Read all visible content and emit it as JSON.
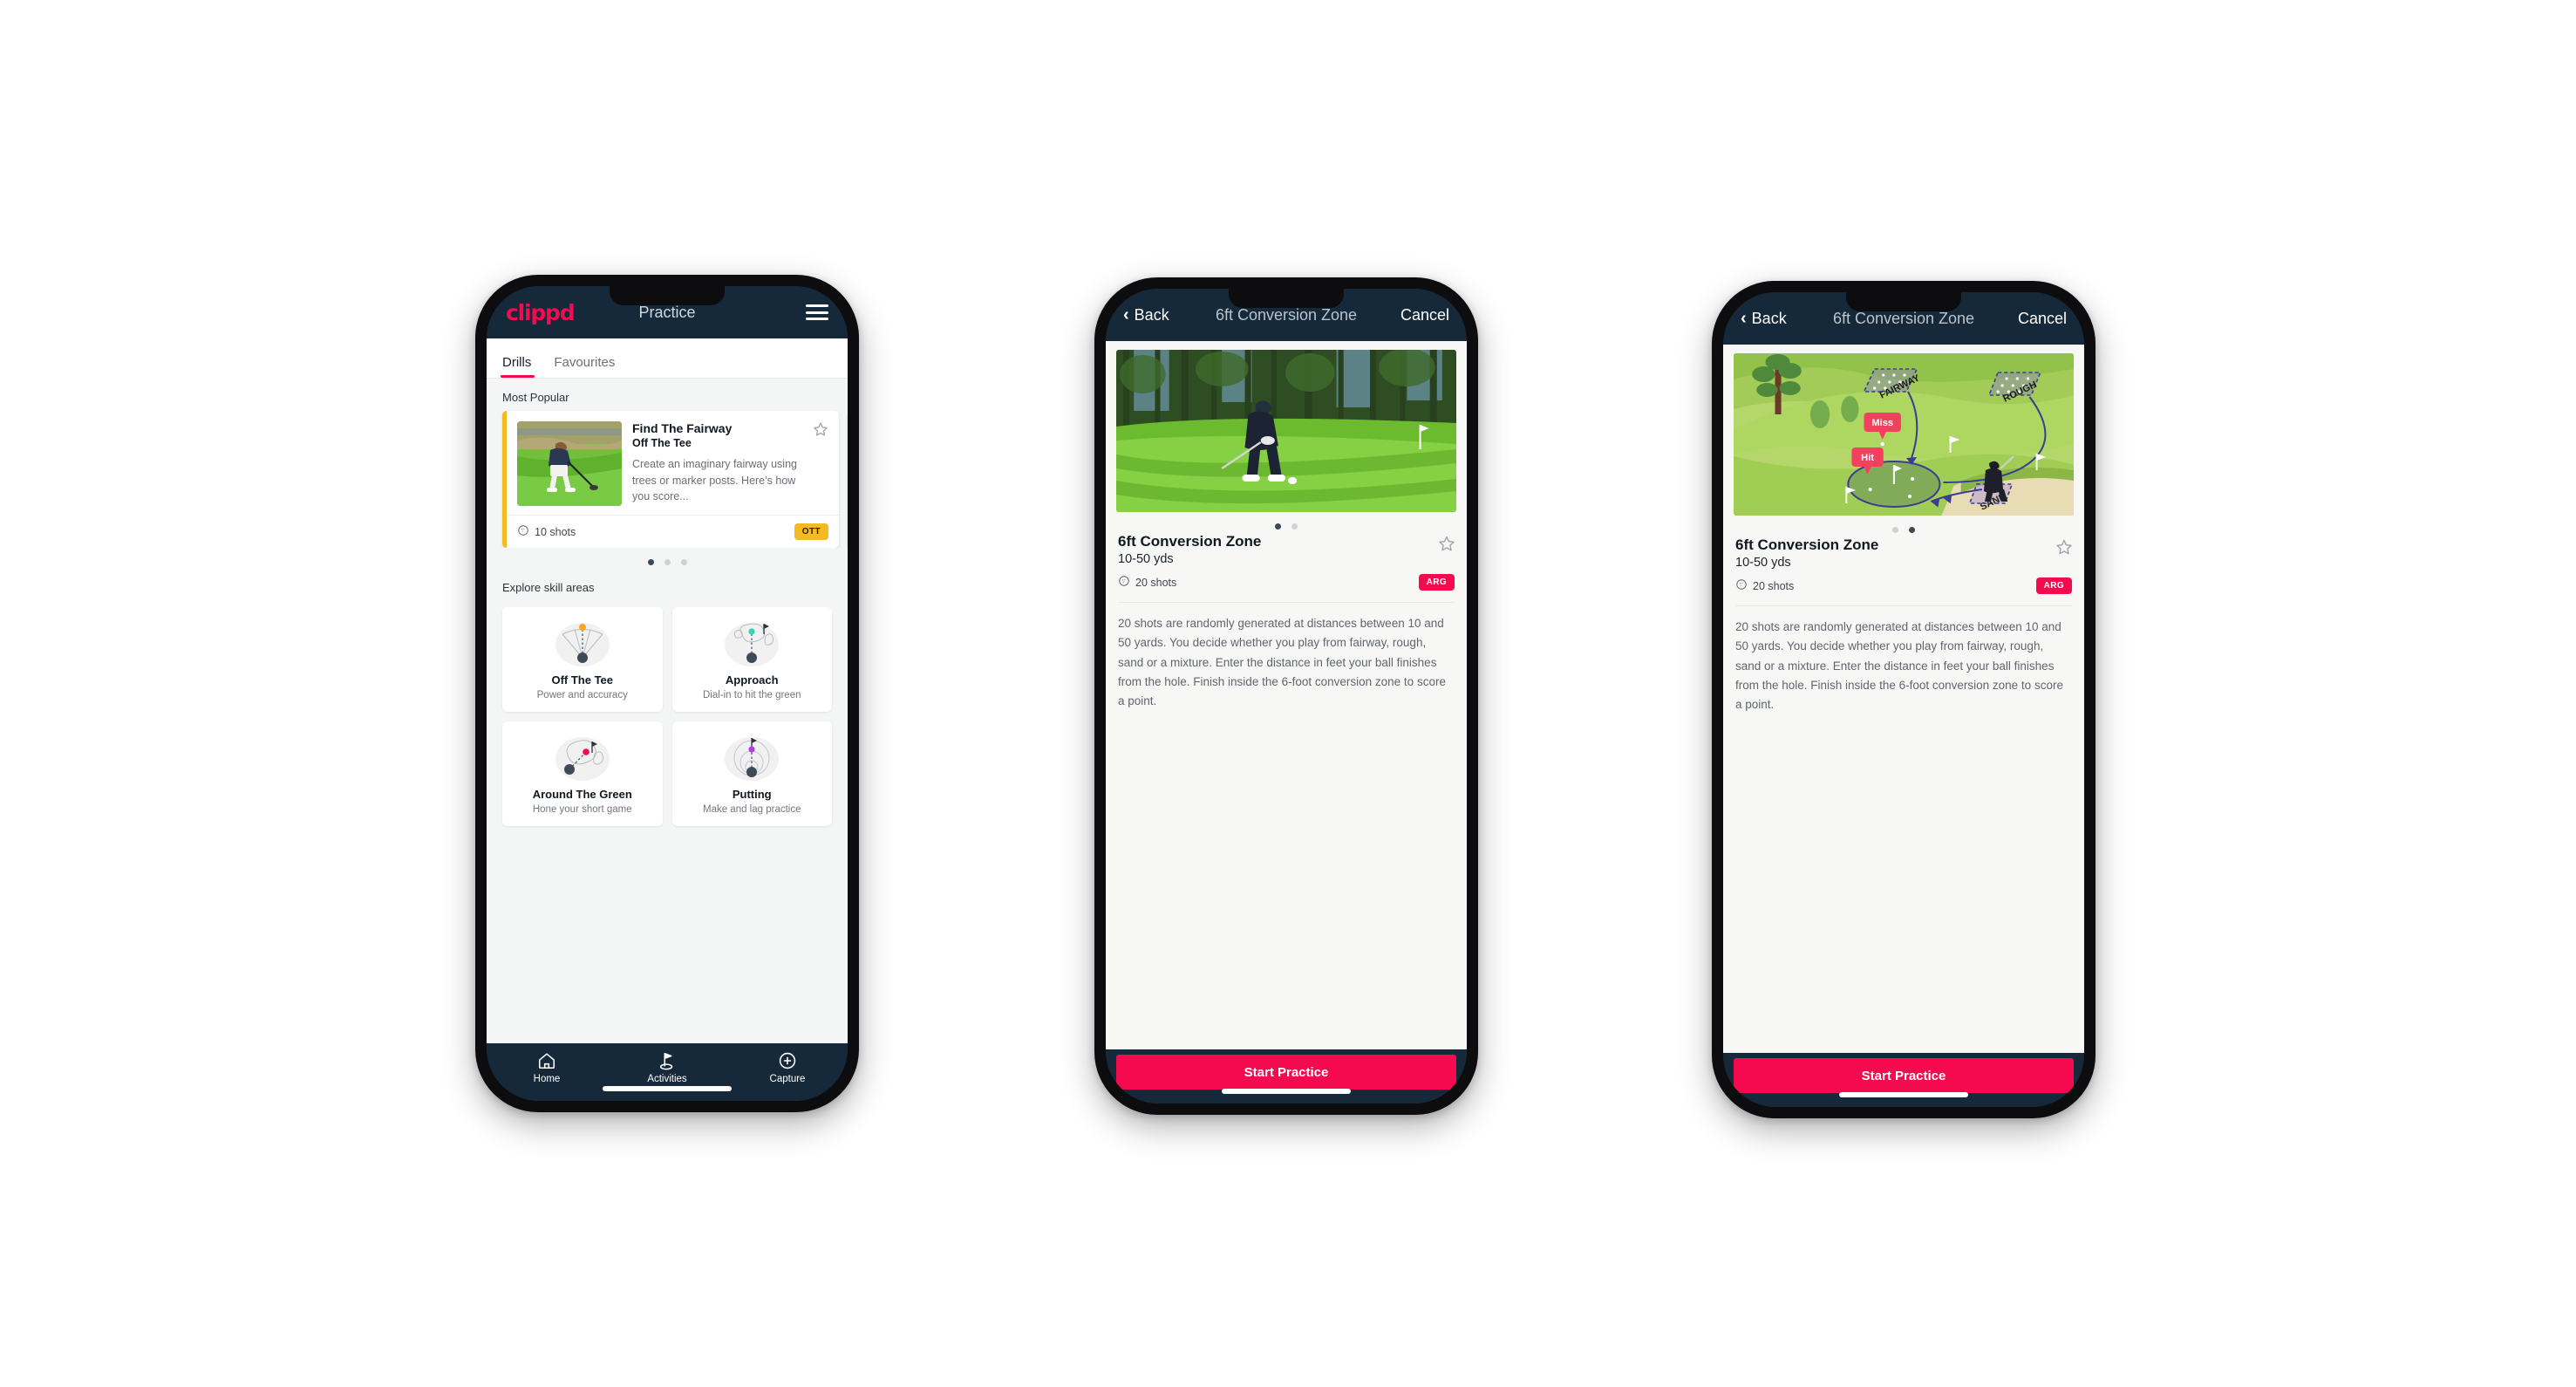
{
  "screens": [
    {
      "id": "practice-list",
      "appbar": {
        "logo": "clippd",
        "title": "Practice",
        "menu_icon": "hamburger-icon"
      },
      "tabs": [
        {
          "label": "Drills",
          "active": true
        },
        {
          "label": "Favourites",
          "active": false
        }
      ],
      "sections": {
        "most_popular": "Most Popular",
        "explore": "Explore skill areas"
      },
      "drill_card": {
        "title": "Find The Fairway",
        "subtitle": "Off The Tee",
        "description": "Create an imaginary fairway using trees or marker posts. Here’s how you score...",
        "shots": "10 shots",
        "badge": "OTT",
        "badge_color": "#f5b921",
        "accent_color": "#f5b921",
        "star_icon": "star-outline-icon"
      },
      "carousel_dots": {
        "count": 3,
        "active_index": 0
      },
      "skill_areas": [
        {
          "name": "Off The Tee",
          "desc": "Power and accuracy",
          "icon": "tee-fan-icon",
          "dot_color": "#f5b921"
        },
        {
          "name": "Approach",
          "desc": "Dial-in to hit the green",
          "icon": "approach-green-icon",
          "dot_color": "#2fd6b4"
        },
        {
          "name": "Around The Green",
          "desc": "Hone your short game",
          "icon": "chip-green-icon",
          "dot_color": "#f50a50"
        },
        {
          "name": "Putting",
          "desc": "Make and lag practice",
          "icon": "putting-rings-icon",
          "dot_color": "#b13ae0"
        }
      ],
      "bottom_nav": [
        {
          "label": "Home",
          "icon": "home-icon",
          "active": false
        },
        {
          "label": "Activities",
          "icon": "golf-flag-icon",
          "active": true
        },
        {
          "label": "Capture",
          "icon": "plus-circle-icon",
          "active": false
        }
      ]
    },
    {
      "id": "drill-detail-video",
      "appbar": {
        "back": "Back",
        "title": "6ft Conversion Zone",
        "cancel": "Cancel",
        "back_icon": "chevron-left-icon"
      },
      "hero": "photo-golfer-chipping",
      "carousel_dots": {
        "count": 2,
        "active_index": 0
      },
      "detail": {
        "title": "6ft Conversion Zone",
        "yards": "10-50 yds",
        "shots": "20 shots",
        "badge": "ARG",
        "badge_color": "#f50a50",
        "star_icon": "star-outline-icon",
        "body": "20 shots are randomly generated at distances between 10 and 50 yards. You decide whether you play from fairway, rough, sand or a mixture. Enter the distance in feet your ball finishes from the hole. Finish inside the 6-foot conversion zone to score a point."
      },
      "cta": {
        "label": "Start Practice",
        "color": "#f50a50"
      }
    },
    {
      "id": "drill-detail-diagram",
      "appbar": {
        "back": "Back",
        "title": "6ft Conversion Zone",
        "cancel": "Cancel",
        "back_icon": "chevron-left-icon"
      },
      "hero": "diagram-course-zones",
      "hero_labels": {
        "fairway": "FAIRWAY",
        "rough": "ROUGH",
        "sand": "SAND",
        "miss": "Miss",
        "hit": "Hit"
      },
      "carousel_dots": {
        "count": 2,
        "active_index": 1
      },
      "detail": {
        "title": "6ft Conversion Zone",
        "yards": "10-50 yds",
        "shots": "20 shots",
        "badge": "ARG",
        "badge_color": "#f50a50",
        "star_icon": "star-outline-icon",
        "body": "20 shots are randomly generated at distances between 10 and 50 yards. You decide whether you play from fairway, rough, sand or a mixture. Enter the distance in feet your ball finishes from the hole. Finish inside the 6-foot conversion zone to score a point."
      },
      "cta": {
        "label": "Start Practice",
        "color": "#f50a50"
      }
    }
  ],
  "theme": {
    "brand_pink": "#f50a50",
    "navbar_dark": "#16293a",
    "screen_bg": "#f4f5f5",
    "amber": "#f5b921",
    "teal": "#2fd6b4"
  }
}
